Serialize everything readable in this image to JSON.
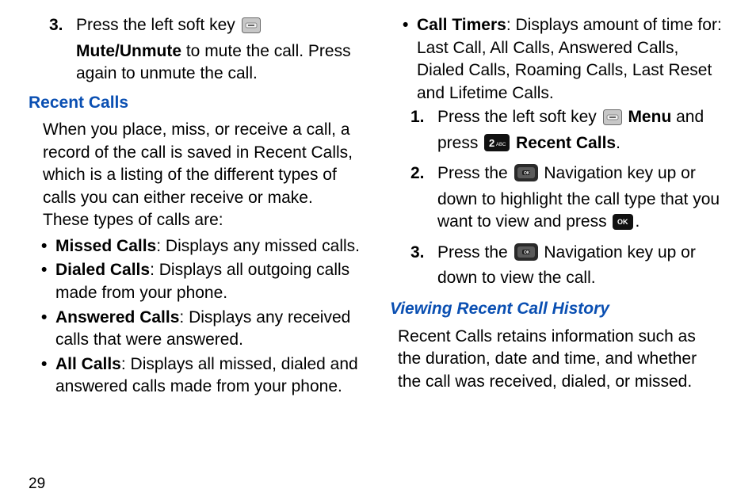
{
  "page_number": "29",
  "left": {
    "step3": {
      "num": "3.",
      "pre": "Press the left soft key ",
      "bold1": "Mute/Unmute",
      "mid": " to mute the call. Press again to unmute the call."
    },
    "heading_recent": "Recent Calls",
    "recent_para": "When you place, miss, or receive a call, a record of the call is saved in Recent Calls, which is a listing of the different types of calls you can either receive or make. These types of calls are:",
    "bullets": {
      "missed": {
        "label": "Missed Calls",
        "text": ": Displays any missed calls."
      },
      "dialed": {
        "label": "Dialed Calls",
        "text": ": Displays all outgoing calls made from your phone."
      },
      "answered": {
        "label": "Answered Calls",
        "text": ": Displays any received calls that were answered."
      },
      "all": {
        "label": "All Calls",
        "text": ": Displays all missed, dialed and answered calls made from your phone."
      }
    }
  },
  "right": {
    "timers": {
      "label": "Call Timers",
      "text": ": Displays amount of time for: Last Call, All Calls, Answered Calls, Dialed Calls, Roaming Calls, Last Reset and Lifetime Calls."
    },
    "steps": {
      "s1": {
        "num": "1.",
        "pre": "Press the left soft key ",
        "bold_menu": "Menu",
        "mid": " and press ",
        "bold_recent": "Recent Calls",
        "end": "."
      },
      "s2": {
        "num": "2.",
        "pre": "Press the ",
        "mid": " Navigation key up or down to highlight the call type that you want to view and press ",
        "end": "."
      },
      "s3": {
        "num": "3.",
        "pre": "Press the ",
        "mid": " Navigation key up or down to view the call."
      }
    },
    "heading_view": "Viewing Recent Call History",
    "view_para": "Recent Calls retains information such as the duration, date and time, and whether the call was received, dialed, or missed."
  },
  "icons": {
    "softkey": "left-soft-key-icon",
    "navkey": "navigation-key-icon",
    "okkey": "ok-key-icon",
    "twokey": "two-abc-key-icon"
  }
}
